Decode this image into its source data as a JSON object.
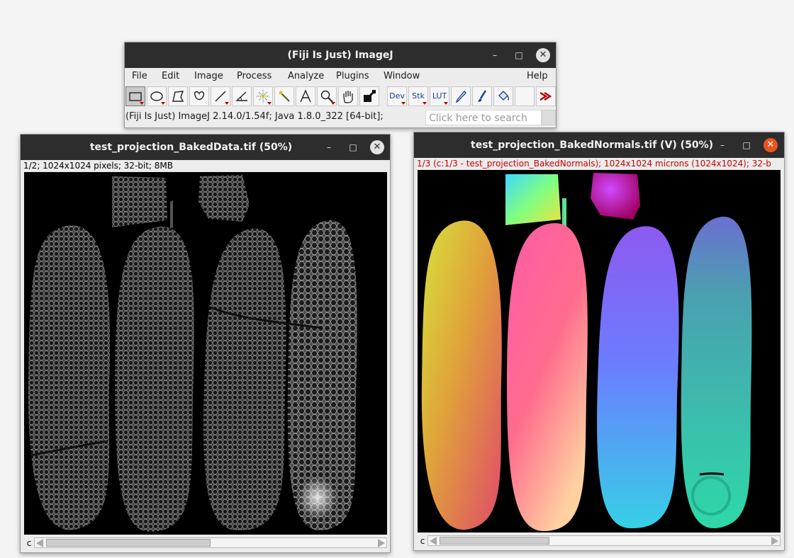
{
  "imagej": {
    "title": "(Fiji Is Just) ImageJ",
    "menu": [
      "File",
      "Edit",
      "Image",
      "Process",
      "Analyze",
      "Plugins",
      "Window",
      "Help"
    ],
    "tools": [
      {
        "name": "rectangle-tool",
        "selected": true
      },
      {
        "name": "oval-tool"
      },
      {
        "name": "polygon-tool"
      },
      {
        "name": "freehand-tool"
      },
      {
        "name": "line-tool"
      },
      {
        "name": "angle-tool"
      },
      {
        "name": "point-tool"
      },
      {
        "name": "wand-tool"
      },
      {
        "name": "text-tool"
      },
      {
        "name": "magnifier-tool"
      },
      {
        "name": "hand-tool"
      },
      {
        "name": "color-picker-tool"
      },
      {
        "name": "dev-tool",
        "label": "Dev"
      },
      {
        "name": "stk-tool",
        "label": "Stk"
      },
      {
        "name": "lut-tool",
        "label": "LUT"
      },
      {
        "name": "pencil-tool"
      },
      {
        "name": "brush-tool"
      },
      {
        "name": "flood-fill-tool"
      },
      {
        "name": "more-tools",
        "icon": "double-arrow-icon"
      }
    ],
    "status": "(Fiji Is Just) ImageJ 2.14.0/1.54f; Java 1.8.0_322 [64-bit];",
    "search_placeholder": "Click here to search"
  },
  "data_window": {
    "title": "test_projection_BakedData.tif (50%)",
    "info": "1/2; 1024x1024 pixels; 32-bit; 8MB",
    "info_color": "#000000",
    "channel": "c",
    "scroll_position": 0.5
  },
  "normals_window": {
    "title": "test_projection_BakedNormals.tif (V) (50%)",
    "info": "1/3 (c:1/3 - test_projection_BakedNormals); 1024x1024 microns (1024x1024); 32-b",
    "info_color": "#cc0000",
    "channel": "c",
    "scroll_position": 0.33
  },
  "window_controls": {
    "minimize": "–",
    "maximize": "□",
    "close": "✕"
  },
  "colors": {
    "titlebar": "#2d2d2d",
    "close_active": "#e95420",
    "window_bg": "#ececec"
  }
}
